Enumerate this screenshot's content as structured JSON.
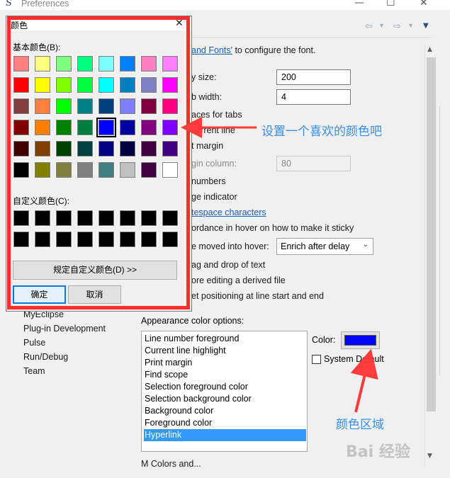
{
  "window": {
    "title": "Preferences",
    "minimize": "—",
    "maximize": "☐",
    "close": "✕"
  },
  "nav": {
    "back": "⇦",
    "back_menu": "▾",
    "forward": "⇨",
    "forward_menu": "▾",
    "view_menu": "▼"
  },
  "tree": {
    "items": [
      "MyEclipse",
      "Plug-in Development",
      "Pulse",
      "Run/Debug",
      "Team"
    ]
  },
  "prefs": {
    "font_link_text": "and Fonts'",
    "font_suffix": " to configure the font.",
    "undo_label": "y size:",
    "undo_value": "200",
    "tab_label": "b width:",
    "tab_value": "4",
    "spaces_tabs": "aces for tabs",
    "current_line": "current line",
    "print_margin": "t margin",
    "margin_column": "gin column:",
    "margin_value": "80",
    "line_numbers": "numbers",
    "range_indicator": "ge indicator",
    "whitespace": "tespace characters",
    "affordance": "ordance in hover on how to make it sticky",
    "hover_label": "e moved into hover:",
    "hover_value": "Enrich after delay",
    "drag_drop": "ag and drop of text",
    "derived_file": "ore editing a derived file",
    "caret_pos": "et positioning at line start and end",
    "appearance_label": "Appearance color options:",
    "color_label": "Color:",
    "system_default": "System Default",
    "bottom_text": "M                                  Colors and..."
  },
  "color_options": [
    "Line number foreground",
    "Current line highlight",
    "Print margin",
    "Find scope",
    "Selection foreground color",
    "Selection background color",
    "Background color",
    "Foreground color",
    "Hyperlink"
  ],
  "selected_color_option": "Hyperlink",
  "current_color": "#0000ff",
  "color_dialog": {
    "title": "颜色",
    "close": "✕",
    "basic_label": "基本颜色(B):",
    "custom_label": "自定义颜色(C):",
    "define_custom": "规定自定义颜色(D) >>",
    "ok": "确定",
    "cancel": "取消",
    "basic_colors": [
      "#ff8080",
      "#ffff80",
      "#80ff80",
      "#00ff80",
      "#80ffff",
      "#0080ff",
      "#ff80c0",
      "#ff80ff",
      "#ff0000",
      "#ffff00",
      "#80ff00",
      "#00ff40",
      "#00ffff",
      "#0080c0",
      "#8080c0",
      "#ff00ff",
      "#804040",
      "#ff8040",
      "#00ff00",
      "#008080",
      "#004080",
      "#8080ff",
      "#800040",
      "#ff0080",
      "#800000",
      "#ff8000",
      "#008000",
      "#008040",
      "#0000ff",
      "#0000a0",
      "#800080",
      "#8000ff",
      "#400000",
      "#804000",
      "#004000",
      "#004040",
      "#000080",
      "#000040",
      "#400040",
      "#400080",
      "#000000",
      "#808000",
      "#808040",
      "#808080",
      "#408080",
      "#c0c0c0",
      "#400040",
      "#ffffff"
    ],
    "selected_index": 28,
    "custom_colors": [
      "#000000",
      "#000000",
      "#000000",
      "#000000",
      "#000000",
      "#000000",
      "#000000",
      "#000000",
      "#000000",
      "#000000",
      "#000000",
      "#000000",
      "#000000",
      "#000000",
      "#000000",
      "#000000"
    ]
  },
  "annotations": {
    "dialog_note": "设置一个喜欢的颜色吧",
    "color_area_note": "颜色区域",
    "watermark": "Bai 经验"
  }
}
